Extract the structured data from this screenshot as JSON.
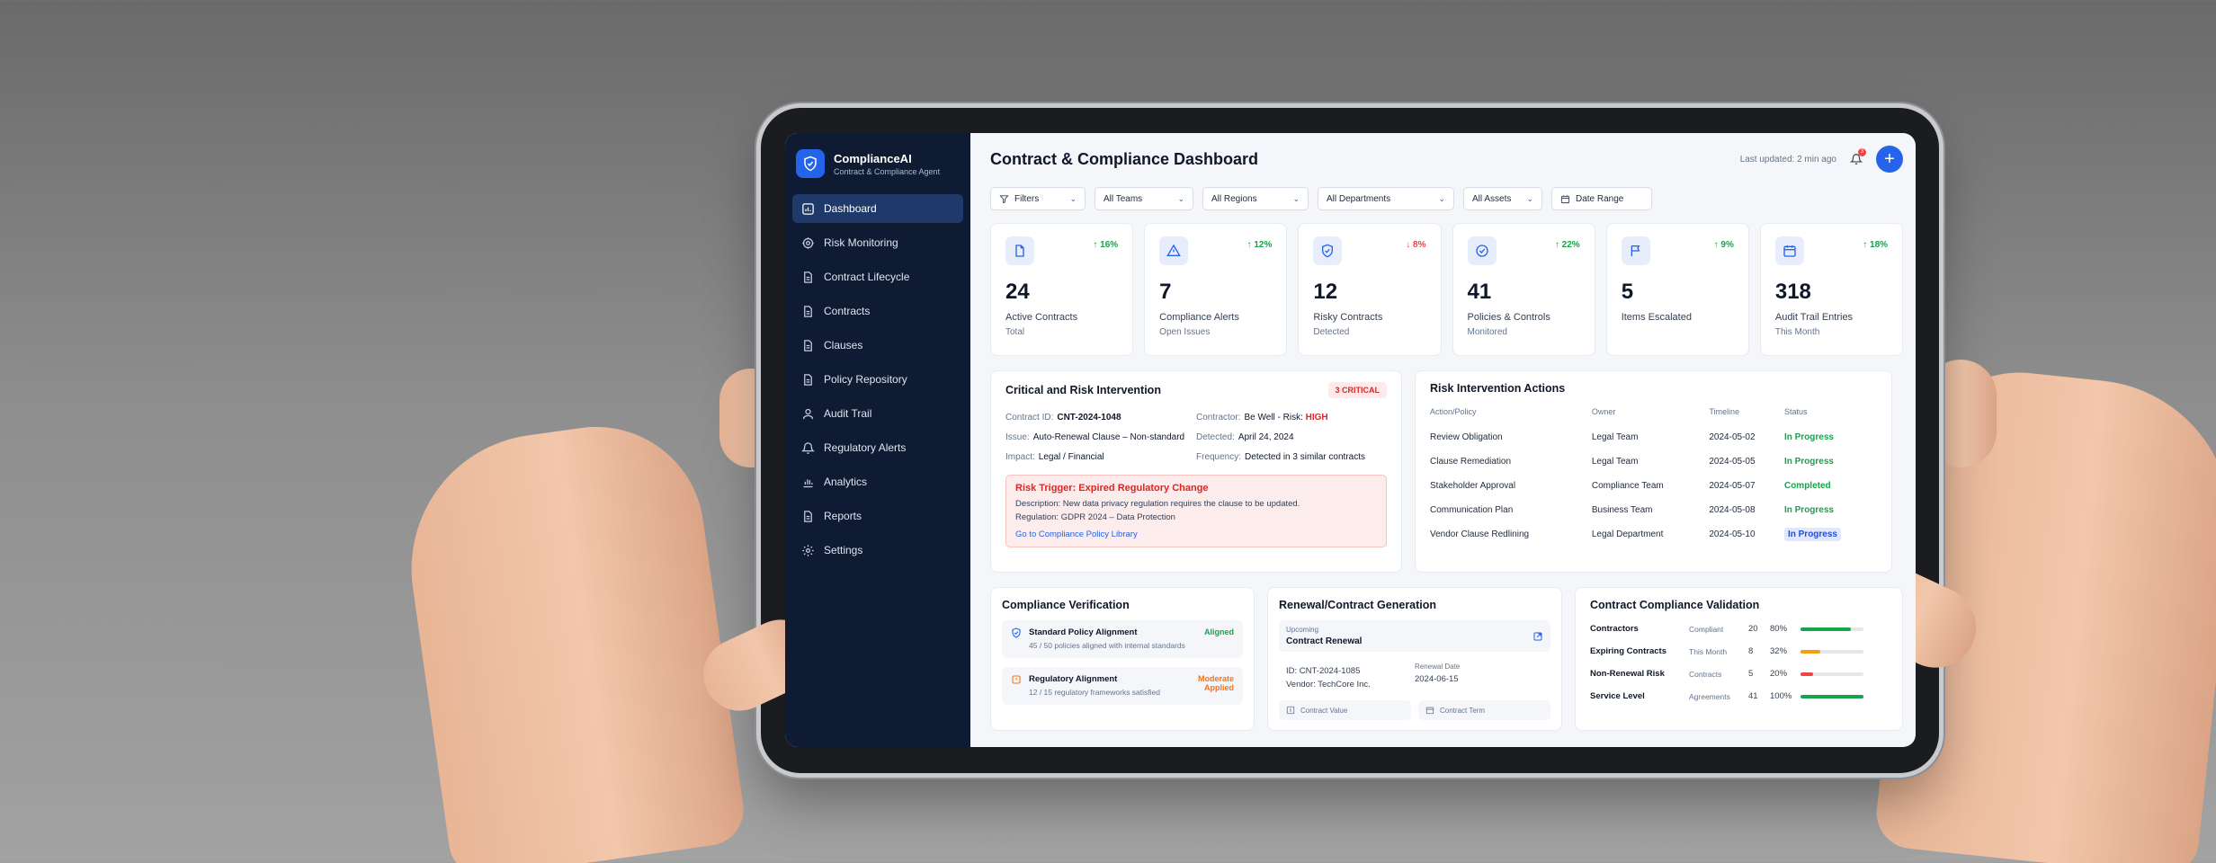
{
  "brand": {
    "title": "ComplianceAI",
    "subtitle": "Contract & Compliance Agent"
  },
  "sidebar": {
    "items": [
      {
        "label": "Dashboard",
        "icon": "dashboard-icon",
        "active": true
      },
      {
        "label": "Risk Monitoring",
        "icon": "risk-icon"
      },
      {
        "label": "Contract Lifecycle",
        "icon": "document-icon"
      },
      {
        "label": "Contracts",
        "icon": "document-icon"
      },
      {
        "label": "Clauses",
        "icon": "document-icon"
      },
      {
        "label": "Policy Repository",
        "icon": "document-icon"
      },
      {
        "label": "Audit Trail",
        "icon": "user-icon"
      },
      {
        "label": "Regulatory Alerts",
        "icon": "bell-icon"
      },
      {
        "label": "Analytics",
        "icon": "chart-icon"
      },
      {
        "label": "Reports",
        "icon": "document-icon"
      },
      {
        "label": "Settings",
        "icon": "gear-icon"
      }
    ]
  },
  "header": {
    "title": "Contract & Compliance Dashboard",
    "last_updated": "Last updated: 2 min ago",
    "notification_count": "3",
    "add_label": "+"
  },
  "filters": {
    "filters": "Filters",
    "teams": "All Teams",
    "regions": "All Regions",
    "departments": "All Departments",
    "assets": "All Assets",
    "date": "Date Range"
  },
  "stats": [
    {
      "value": "24",
      "label": "Active Contracts",
      "sub": "Total",
      "delta": "↑ 16%",
      "trend": "up",
      "icon": "file-icon"
    },
    {
      "value": "7",
      "label": "Compliance Alerts",
      "sub": "Open Issues",
      "delta": "↑ 12%",
      "trend": "up",
      "icon": "warning-icon"
    },
    {
      "value": "12",
      "label": "Risky Contracts",
      "sub": "Detected",
      "delta": "↓ 8%",
      "trend": "down",
      "icon": "shield-icon"
    },
    {
      "value": "41",
      "label": "Policies & Controls",
      "sub": "Monitored",
      "delta": "↑ 22%",
      "trend": "up",
      "icon": "check-circle-icon"
    },
    {
      "value": "5",
      "label": "Items Escalated",
      "sub": "",
      "delta": "↑ 9%",
      "trend": "up",
      "icon": "flag-icon"
    },
    {
      "value": "318",
      "label": "Audit Trail Entries",
      "sub": "This Month",
      "delta": "↑ 18%",
      "trend": "up",
      "icon": "calendar-icon"
    }
  ],
  "critical": {
    "title": "Critical and Risk Intervention",
    "badge": "3 CRITICAL",
    "contract_id_k": "Contract ID:",
    "contract_id_v": "CNT-2024-1048",
    "contractor_k": "Contractor:",
    "contractor_v": "Be Well - Risk:",
    "contractor_risk": "HIGH",
    "issue_k": "Issue:",
    "issue_v": "Auto-Renewal Clause – Non-standard",
    "detected_k": "Detected:",
    "detected_v": "April 24, 2024",
    "impact_k": "Impact:",
    "impact_v": "Legal / Financial",
    "frequency_k": "Frequency:",
    "frequency_v": "Detected in 3 similar contracts",
    "risk_title": "Risk Trigger: Expired Regulatory Change",
    "risk_desc": "Description:  New data privacy regulation requires the clause to be updated.",
    "risk_reg": "Regulation:  GDPR 2024 – Data Protection",
    "risk_link": "Go to Compliance Policy Library"
  },
  "actions": {
    "title": "Risk Intervention Actions",
    "headers": [
      "Action/Policy",
      "Owner",
      "Timeline",
      "Status"
    ],
    "rows": [
      {
        "action": "Review Obligation",
        "owner": "Legal Team",
        "timeline": "2024-05-02",
        "status": "In Progress",
        "kind": "progress"
      },
      {
        "action": "Clause Remediation",
        "owner": "Legal Team",
        "timeline": "2024-05-05",
        "status": "In Progress",
        "kind": "progress"
      },
      {
        "action": "Stakeholder Approval",
        "owner": "Compliance Team",
        "timeline": "2024-05-07",
        "status": "Completed",
        "kind": "done"
      },
      {
        "action": "Communication Plan",
        "owner": "Business Team",
        "timeline": "2024-05-08",
        "status": "In Progress",
        "kind": "progress"
      },
      {
        "action": "Vendor Clause Redlining",
        "owner": "Legal Department",
        "timeline": "2024-05-10",
        "status": "In Progress",
        "kind": "pill"
      }
    ]
  },
  "verification": {
    "title": "Compliance Verification",
    "items": [
      {
        "title": "Standard Policy Alignment",
        "sub": "45 / 50 policies aligned with internal standards",
        "status": "Aligned"
      },
      {
        "title": "Regulatory Alignment",
        "sub": "12 / 15 regulatory frameworks satisfied",
        "status": "Moderate Applied"
      }
    ]
  },
  "renewal": {
    "title": "Renewal/Contract Generation",
    "upcoming": "Upcoming",
    "name": "Contract Renewal",
    "id": "ID:  CNT-2024-1085",
    "vendor": "Vendor:  TechCore Inc.",
    "renewal_date_label": "Renewal Date",
    "renewal_date": "2024-06-15",
    "value_label": "Contract Value",
    "term_label": "Contract Term"
  },
  "validation": {
    "title": "Contract Compliance Validation",
    "rows": [
      {
        "name": "Contractors",
        "cat": "Compliant",
        "n": "20",
        "pct": "80%",
        "fill": 0.8,
        "color": "#16a34a"
      },
      {
        "name": "Expiring Contracts",
        "cat": "This Month",
        "n": "8",
        "pct": "32%",
        "fill": 0.32,
        "color": "#f59e0b"
      },
      {
        "name": "Non-Renewal Risk",
        "cat": "Contracts",
        "n": "5",
        "pct": "20%",
        "fill": 0.2,
        "color": "#ef4444"
      },
      {
        "name": "Service Level",
        "cat": "Agreements",
        "n": "41",
        "pct": "100%",
        "fill": 1.0,
        "color": "#16a34a"
      }
    ]
  }
}
